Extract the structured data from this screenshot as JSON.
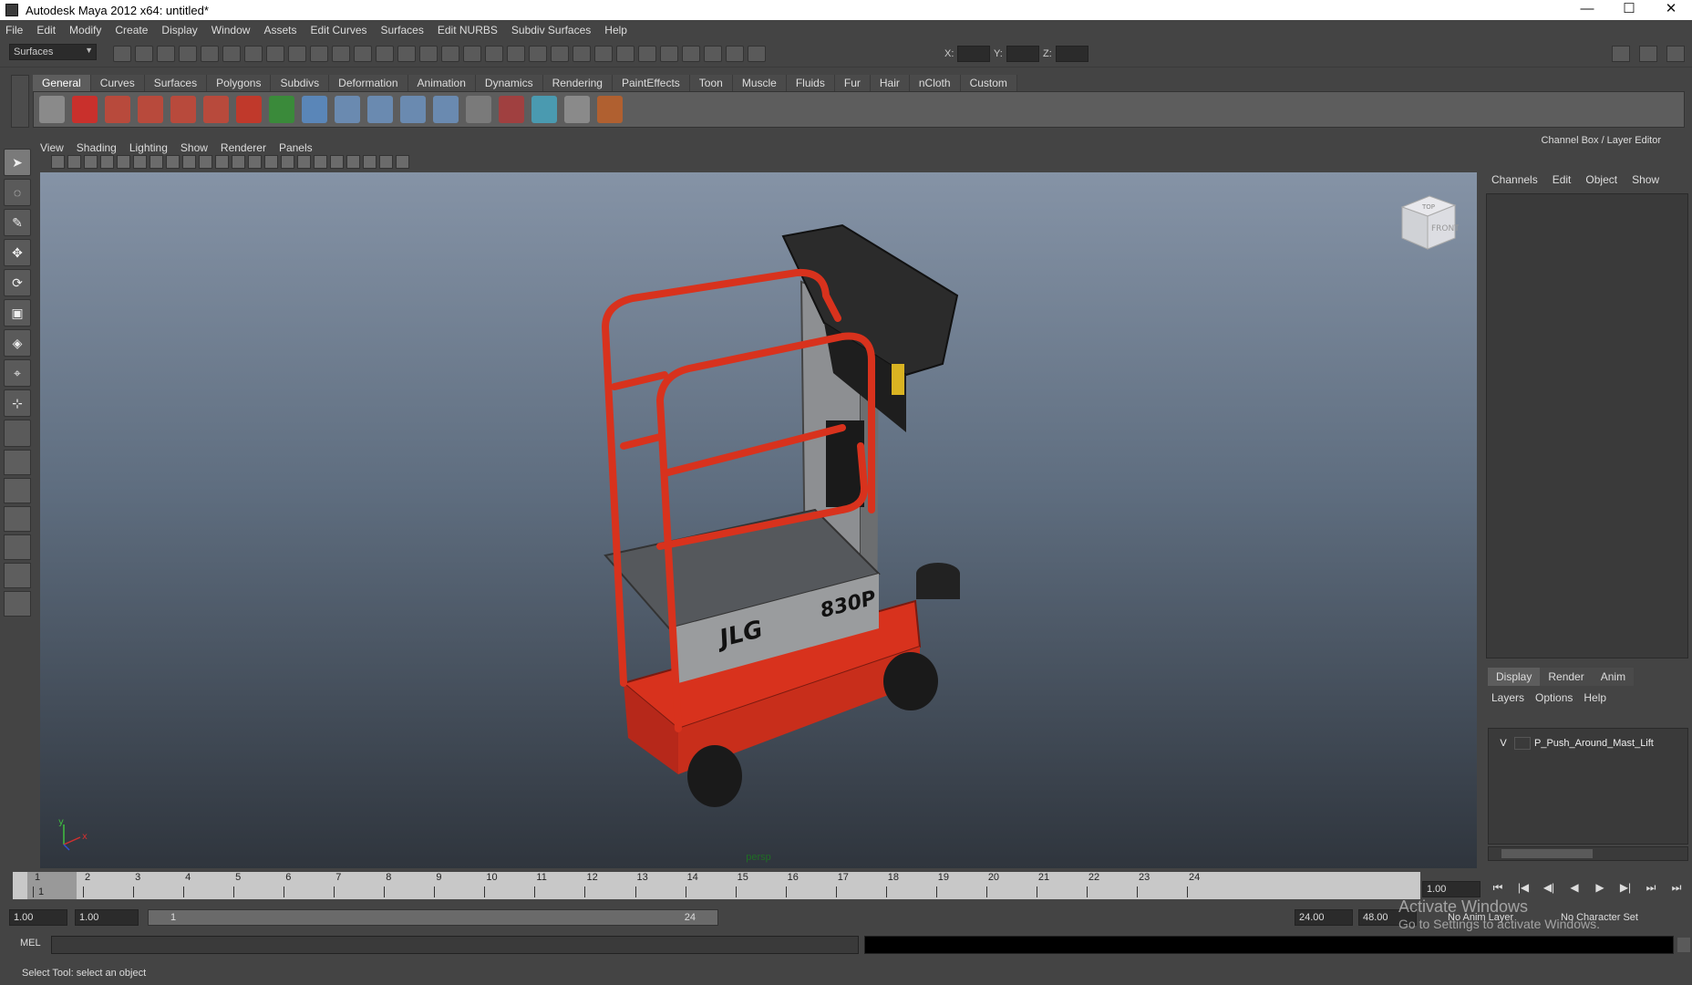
{
  "window": {
    "title": "Autodesk Maya 2012 x64: untitled*",
    "controls": [
      "—",
      "☐",
      "✕"
    ]
  },
  "menubar": [
    "File",
    "Edit",
    "Modify",
    "Create",
    "Display",
    "Window",
    "Assets",
    "Edit Curves",
    "Surfaces",
    "Edit NURBS",
    "Subdiv Surfaces",
    "Help"
  ],
  "statusline": {
    "mode": "Surfaces",
    "x_label": "X:",
    "y_label": "Y:",
    "z_label": "Z:"
  },
  "shelf": {
    "tabs": [
      "General",
      "Curves",
      "Surfaces",
      "Polygons",
      "Subdivs",
      "Deformation",
      "Animation",
      "Dynamics",
      "Rendering",
      "PaintEffects",
      "Toon",
      "Muscle",
      "Fluids",
      "Fur",
      "Hair",
      "nCloth",
      "Custom"
    ],
    "active_tab": "General"
  },
  "panel": {
    "menus": [
      "View",
      "Shading",
      "Lighting",
      "Show",
      "Renderer",
      "Panels"
    ],
    "camera": "persp",
    "viewcube": {
      "top": "TOP",
      "front": "FRONT"
    },
    "axis": {
      "y": "y",
      "x": "x"
    },
    "model_labels": {
      "brand": "JLG",
      "model": "830P"
    }
  },
  "channel_box": {
    "title": "Channel Box / Layer Editor",
    "menus": [
      "Channels",
      "Edit",
      "Object",
      "Show"
    ]
  },
  "layer_editor": {
    "tabs": [
      "Display",
      "Render",
      "Anim"
    ],
    "active_tab": "Display",
    "menus": [
      "Layers",
      "Options",
      "Help"
    ],
    "layers": [
      {
        "visible": "V",
        "name": "P_Push_Around_Mast_Lift"
      }
    ]
  },
  "timeline": {
    "ticks": [
      "1",
      "2",
      "3",
      "4",
      "5",
      "6",
      "7",
      "8",
      "9",
      "10",
      "11",
      "12",
      "13",
      "14",
      "15",
      "16",
      "17",
      "18",
      "19",
      "20",
      "21",
      "22",
      "23",
      "24"
    ],
    "current_marker": "1",
    "current_frame": "1.00",
    "playback_buttons": [
      "⏮",
      "|◀",
      "◀|",
      "◀",
      "▶",
      "▶|",
      "⏭",
      "⏭"
    ]
  },
  "range": {
    "start_time": "1.00",
    "playback_start": "1.00",
    "slider_start": "1",
    "slider_end": "24",
    "playback_end": "24.00",
    "end_time": "48.00",
    "anim_layer": "No Anim Layer",
    "character_set": "No Character Set"
  },
  "command_line": {
    "label": "MEL"
  },
  "help_line": "Select Tool: select an object",
  "watermark": {
    "line1": "Activate Windows",
    "line2": "Go to Settings to activate Windows."
  },
  "colors": {
    "viewport_top": "#8593a6",
    "viewport_bottom": "#2f353d",
    "lift_red": "#d8321d",
    "persp": "#1f6d24"
  }
}
